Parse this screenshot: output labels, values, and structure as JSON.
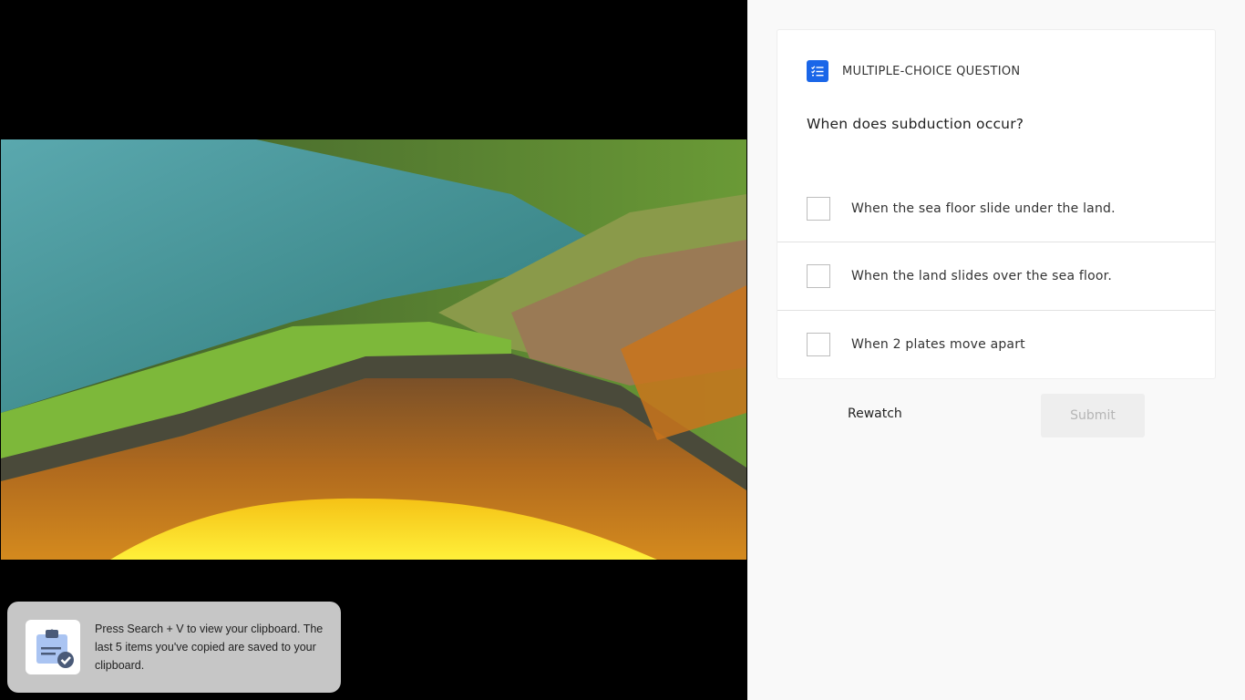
{
  "video": {
    "scene": "subduction-cross-section"
  },
  "toast": {
    "icon": "clipboard-check-icon",
    "message": "Press Search + V to view your clipboard. The last 5 items you've copied are saved to your clipboard."
  },
  "question": {
    "type_icon": "checklist-icon",
    "type_label": "MULTIPLE-CHOICE QUESTION",
    "prompt": "When does subduction occur?",
    "options": [
      {
        "label": "When the sea floor slide under the land.",
        "checked": false
      },
      {
        "label": "When the land slides over the sea floor.",
        "checked": false
      },
      {
        "label": "When 2 plates move apart",
        "checked": false
      }
    ]
  },
  "actions": {
    "rewatch_label": "Rewatch",
    "submit_label": "Submit",
    "submit_enabled": false
  },
  "colors": {
    "accent": "#1a66e8",
    "panel_bg": "#f9f9f9",
    "toast_bg": "#c6c6c6"
  }
}
